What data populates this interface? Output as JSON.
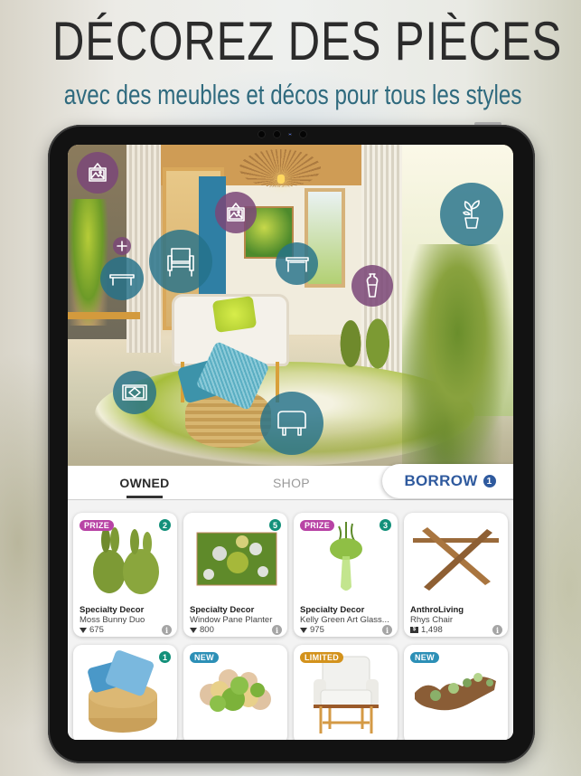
{
  "promo": {
    "headline": "DÉCOREZ DES PIÈCES",
    "subheadline": "avec des meubles et décos pour tous les styles"
  },
  "room": {
    "hotspots": [
      {
        "icon": "picture-frame-icon",
        "color": "purple"
      },
      {
        "icon": "plus-icon",
        "color": "purple"
      },
      {
        "icon": "coffee-table-icon",
        "color": "teal"
      },
      {
        "icon": "armchair-icon",
        "color": "teal"
      },
      {
        "icon": "picture-frame-icon",
        "color": "purple"
      },
      {
        "icon": "console-table-icon",
        "color": "teal"
      },
      {
        "icon": "vase-icon",
        "color": "purple"
      },
      {
        "icon": "potted-plant-icon",
        "color": "teal"
      },
      {
        "icon": "rug-icon",
        "color": "teal"
      },
      {
        "icon": "ottoman-icon",
        "color": "teal"
      }
    ]
  },
  "tabs": {
    "owned": "OWNED",
    "shop": "SHOP",
    "borrow": "BORROW",
    "borrow_count": "1",
    "active": "OWNED"
  },
  "colors": {
    "teal_hotspot": "#24718a",
    "purple_hotspot": "#7a4678",
    "borrow_blue": "#2f5a9e",
    "prize_tag": "#b843a5",
    "new_tag": "#2c8fb6",
    "limited_tag": "#d3921c",
    "count_badge": "#13907a"
  },
  "items": [
    {
      "tag": "PRIZE",
      "count": "2",
      "brand": "Specialty Decor",
      "name": "Moss Bunny Duo",
      "currency": "gems",
      "price": "675"
    },
    {
      "tag": "",
      "count": "5",
      "brand": "Specialty Decor",
      "name": "Window Pane Planter",
      "currency": "gems",
      "price": "800"
    },
    {
      "tag": "PRIZE",
      "count": "3",
      "brand": "Specialty Decor",
      "name": "Kelly Green Art Glass...",
      "currency": "gems",
      "price": "975"
    },
    {
      "tag": "",
      "count": "",
      "brand": "AnthroLiving",
      "name": "Rhys Chair",
      "currency": "cash",
      "price": "1,498"
    },
    {
      "tag": "",
      "count": "1",
      "brand": "",
      "name": "",
      "currency": "",
      "price": ""
    },
    {
      "tag": "NEW",
      "count": "",
      "brand": "",
      "name": "",
      "currency": "",
      "price": ""
    },
    {
      "tag": "LIMITED",
      "count": "",
      "brand": "",
      "name": "",
      "currency": "",
      "price": ""
    },
    {
      "tag": "NEW",
      "count": "",
      "brand": "",
      "name": "",
      "currency": "",
      "price": ""
    }
  ],
  "icons": {
    "info": "i",
    "cash": "$"
  }
}
